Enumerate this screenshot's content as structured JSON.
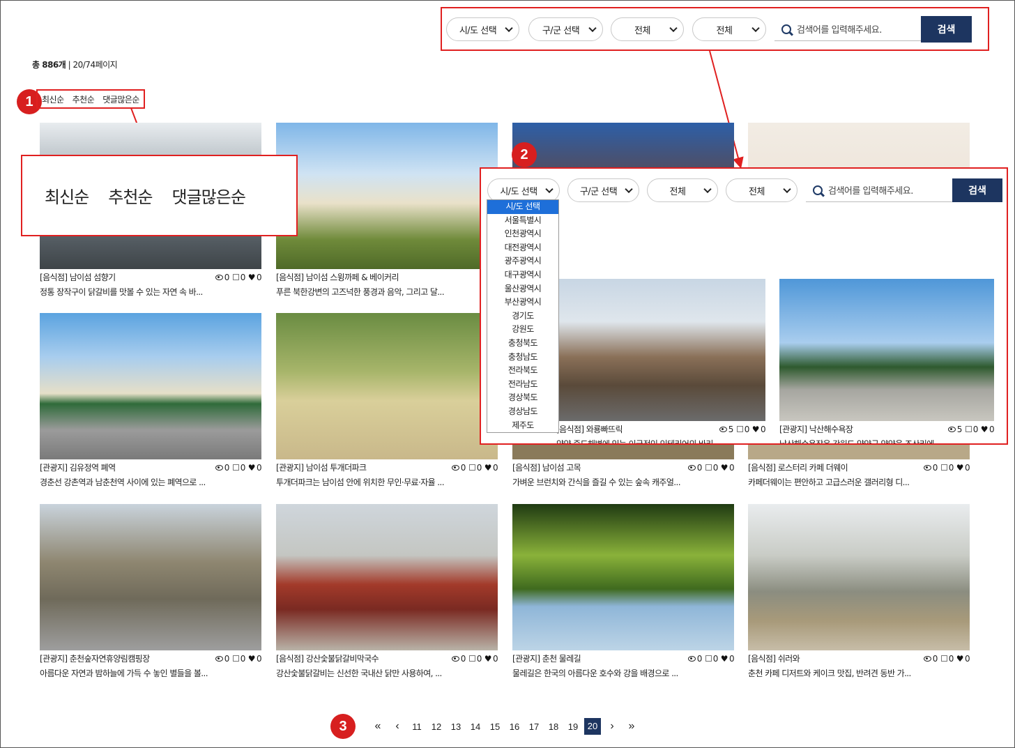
{
  "filters": {
    "sido": "시/도 선택",
    "gugun": "구/군 선택",
    "type1": "전체",
    "type2": "전체",
    "search_placeholder": "검색어를 입력해주세요.",
    "search_button": "검색"
  },
  "count": {
    "total": "총 886개",
    "page": "| 20/74페이지"
  },
  "sort": {
    "latest": "최신순",
    "recommend": "추천순",
    "comments": "댓글많은순"
  },
  "badges": {
    "one": "1",
    "two": "2",
    "three": "3"
  },
  "cards": [
    {
      "title": "[음식점] 남이섬 섬향기",
      "views": "0",
      "comments": "0",
      "likes": "0",
      "desc": "정통 장작구이 닭갈비를 맛볼 수 있는 자연 속 바..."
    },
    {
      "title": "[음식점] 남이섬 스윙까페 & 베이커리",
      "views": "0",
      "comments": "0",
      "likes": "0",
      "desc": "푸른 북한강변의 고즈넉한 풍경과 음악, 그리고 달..."
    },
    {
      "title": "[관광지] 김유정역 폐역",
      "views": "0",
      "comments": "0",
      "likes": "0",
      "desc": "경춘선 강촌역과 남춘천역 사이에 있는 폐역으로 ..."
    },
    {
      "title": "[관광지] 남이섬 투개더파크",
      "views": "0",
      "comments": "0",
      "likes": "0",
      "desc": "투개더파크는 남이섬 안에 위치한 무인·무료·자율 ..."
    },
    {
      "title": "[음식점] 남이섬 고목",
      "views": "0",
      "comments": "0",
      "likes": "0",
      "desc": "가벼운 브런치와 간식을 즐길 수 있는 숲속 캐주얼..."
    },
    {
      "title": "[음식점] 로스터리 카페 더웨이",
      "views": "0",
      "comments": "0",
      "likes": "0",
      "desc": "카페더웨이는 편안하고 고급스러운 갤러리형 디..."
    },
    {
      "title": "[관광지] 춘천숲자연휴양림캠핑장",
      "views": "0",
      "comments": "0",
      "likes": "0",
      "desc": "아름다운 자연과 밤하늘에 가득 수 놓인 별들을 볼..."
    },
    {
      "title": "[음식점] 강산숯불닭갈비막국수",
      "views": "0",
      "comments": "0",
      "likes": "0",
      "desc": "강산숯불닭갈비는 신선한 국내산 닭만 사용하여, ..."
    },
    {
      "title": "[관광지] 춘천 물레길",
      "views": "0",
      "comments": "0",
      "likes": "0",
      "desc": "물레길은 한국의 아름다운 호수와 강을 배경으로 ..."
    },
    {
      "title": "[음식점] 쉬러와",
      "views": "0",
      "comments": "0",
      "likes": "0",
      "desc": "춘천 카페 디저트와 케이크 맛집, 반려견 동반 가..."
    }
  ],
  "zoom_cards": [
    {
      "title": "[음식점] 와룡빠뜨릭",
      "views": "5",
      "comments": "0",
      "likes": "0",
      "desc": "양양 죽도해변에 있는 이국적인 인테리어의 바리..."
    },
    {
      "title": "[관광지] 낙산해수욕장",
      "views": "5",
      "comments": "0",
      "likes": "0",
      "desc": "낙산해수욕장은 강원도 양양군 양양읍 조산리에..."
    }
  ],
  "dropdown_options": [
    "시/도 선택",
    "서울특별시",
    "인천광역시",
    "대전광역시",
    "광주광역시",
    "대구광역시",
    "울산광역시",
    "부산광역시",
    "경기도",
    "강원도",
    "충청북도",
    "충청남도",
    "전라북도",
    "전라남도",
    "경상북도",
    "경상남도",
    "제주도"
  ],
  "pagination": {
    "first": "«",
    "prev": "‹",
    "pages": [
      "11",
      "12",
      "13",
      "14",
      "15",
      "16",
      "17",
      "18",
      "19"
    ],
    "current": "20",
    "next": "›",
    "last": "»"
  },
  "colors": {
    "accent_red": "#e02020",
    "navy": "#1d3560",
    "dropdown_highlight": "#1e6fd9"
  }
}
